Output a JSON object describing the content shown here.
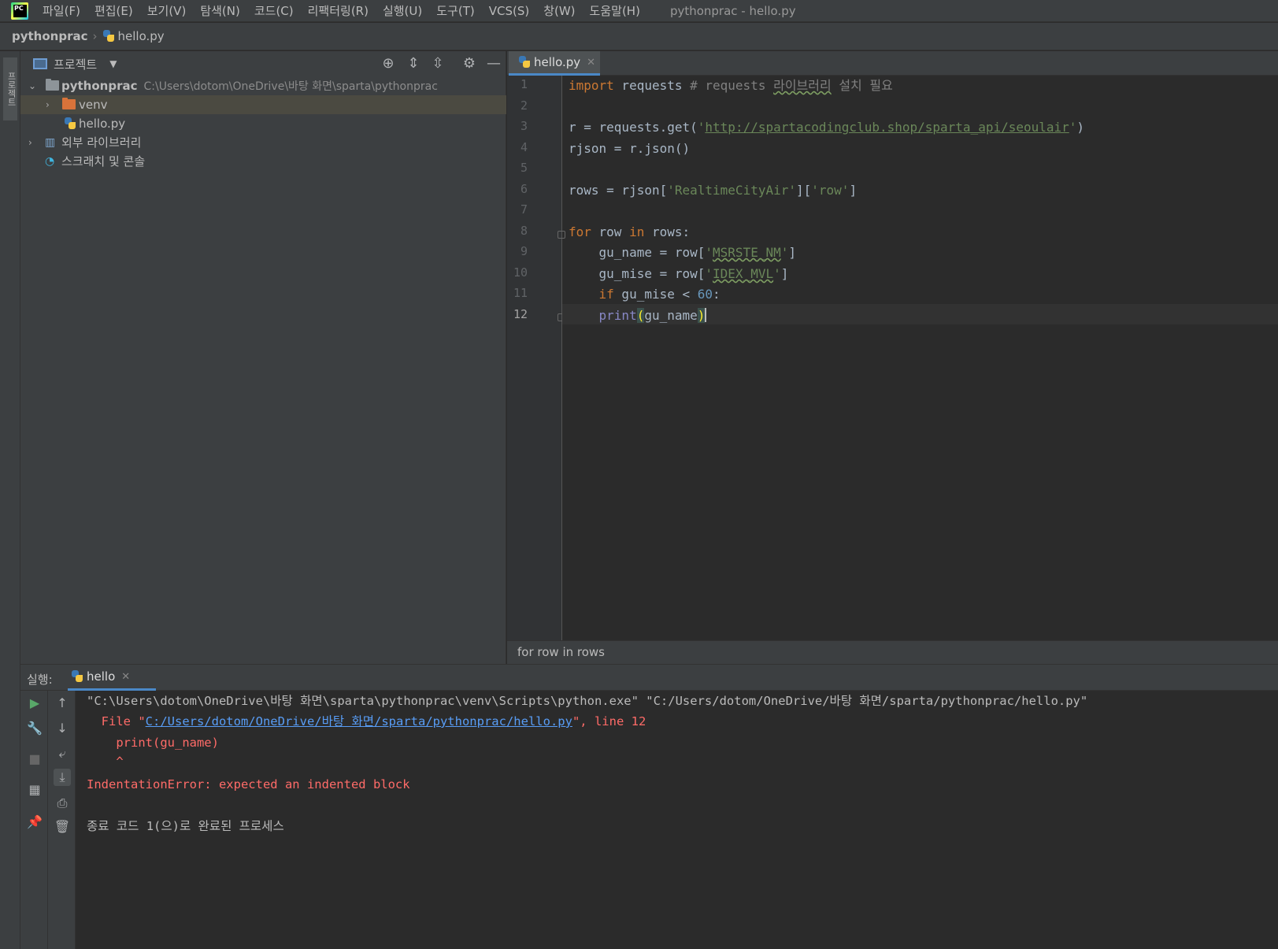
{
  "menu": {
    "items": [
      "파일(F)",
      "편집(E)",
      "보기(V)",
      "탐색(N)",
      "코드(C)",
      "리팩터링(R)",
      "실행(U)",
      "도구(T)",
      "VCS(S)",
      "창(W)",
      "도움말(H)"
    ],
    "window_title": "pythonprac - hello.py"
  },
  "breadcrumb": {
    "project": "pythonprac",
    "file": "hello.py"
  },
  "left_stripe": {
    "project_label": "프로젝트"
  },
  "project_panel": {
    "title": "프로젝트",
    "root": {
      "name": "pythonprac",
      "path": "C:\\Users\\dotom\\OneDrive\\바탕 화면\\sparta\\pythonprac"
    },
    "venv": "venv",
    "file": "hello.py",
    "external_libs": "외부 라이브러리",
    "scratches": "스크래치 및 콘솔"
  },
  "editor": {
    "tab_label": "hello.py",
    "line_numbers": [
      "1",
      "2",
      "3",
      "4",
      "5",
      "6",
      "7",
      "8",
      "9",
      "10",
      "11",
      "12"
    ],
    "current_line": 12,
    "code": {
      "l1_kw": "import",
      "l1_mod": " requests ",
      "l1_cmt": "# requests ",
      "l1_cmt_ko": "라이브러리",
      "l1_cmt_end": " 설치 필요",
      "l3_a": "r = requests.get(",
      "l3_q1": "'",
      "l3_url": "http://spartacodingclub.shop/sparta_api/seoulair",
      "l3_q2": "'",
      "l3_b": ")",
      "l4": "rjson = r.json()",
      "l6_a": "rows = rjson[",
      "l6_s1": "'RealtimeCityAir'",
      "l6_b": "][",
      "l6_s2": "'row'",
      "l6_c": "]",
      "l8_kw1": "for",
      "l8_a": " row ",
      "l8_kw2": "in",
      "l8_b": " rows:",
      "l9_a": "    gu_name = row[",
      "l9_q1": "'",
      "l9_s": "MSRSTE_NM",
      "l9_q2": "'",
      "l9_b": "]",
      "l10_a": "    gu_mise = row[",
      "l10_q1": "'",
      "l10_s": "IDEX_MVL",
      "l10_q2": "'",
      "l10_b": "]",
      "l11_kw": "    if",
      "l11_a": " gu_mise < ",
      "l11_num": "60",
      "l11_b": ":",
      "l12_indent": "    ",
      "l12_fn": "print",
      "l12_open": "(",
      "l12_arg": "gu_name",
      "l12_close": ")"
    },
    "status": "for row in rows"
  },
  "run_panel": {
    "label": "실행:",
    "tab_label": "hello",
    "console": {
      "cmd": "\"C:\\Users\\dotom\\OneDrive\\바탕 화면\\sparta\\pythonprac\\venv\\Scripts\\python.exe\" \"C:/Users/dotom/OneDrive/바탕 화면/sparta/pythonprac/hello.py\"",
      "file_prefix": "  File \"",
      "file_link": "C:/Users/dotom/OneDrive/바탕 화면/sparta/pythonprac/hello.py",
      "file_suffix": "\", line 12",
      "err_code": "    print(gu_name)",
      "err_caret": "    ^",
      "err_msg": "IndentationError: expected an indented block",
      "exit_msg": "종료 코드 1(으)로 완료된 프로세스"
    }
  },
  "colors": {
    "keyword": "#cc7832",
    "string": "#6a8759",
    "comment": "#808080",
    "number": "#6897bb",
    "error": "#ff6b68",
    "link": "#589df6",
    "accent": "#4a88c7"
  }
}
